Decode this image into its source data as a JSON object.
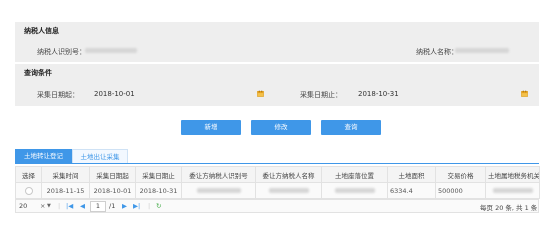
{
  "taxpayer_section": {
    "title": "纳税人信息",
    "id_label": "纳税人识别号：",
    "name_label": "纳税人名称："
  },
  "query_section": {
    "title": "查询条件",
    "start_label": "采集日期起：",
    "start_value": "2018-10-01",
    "end_label": "采集日期止：",
    "end_value": "2018-10-31"
  },
  "buttons": {
    "add": "新增",
    "edit": "修改",
    "query": "查询"
  },
  "tabs": [
    {
      "label": "土地转让登记"
    },
    {
      "label": "土地出让采集"
    }
  ],
  "table": {
    "headers": [
      "选择",
      "采集时间",
      "采集日期起",
      "采集日期止",
      "委让方纳税人识别号",
      "委让方纳税人名称",
      "土地座落位置",
      "土地面积",
      "交易价格",
      "土地属地税务机关"
    ],
    "rows": [
      {
        "collect_time": "2018-11-15",
        "start": "2018-10-01",
        "end": "2018-10-31",
        "area": "6334.4",
        "price": "500000"
      }
    ]
  },
  "pager": {
    "page_size": "20",
    "page_input": "1",
    "page_total": "/1",
    "summary": "每页 20 条, 共 1 条"
  },
  "colors": {
    "accent": "#3f97e8",
    "band": "#eeeeee"
  }
}
